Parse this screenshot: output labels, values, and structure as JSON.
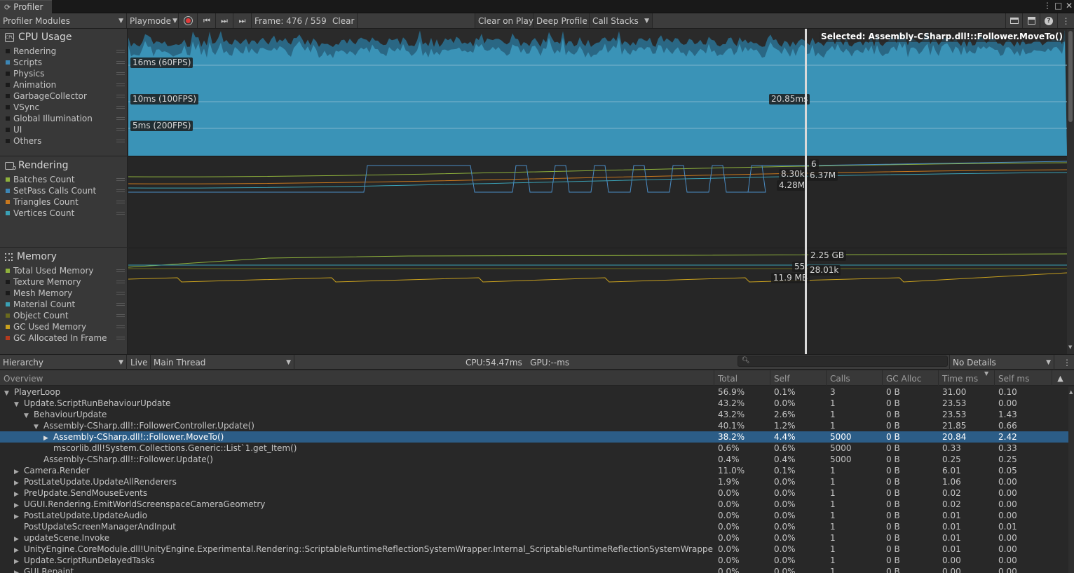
{
  "window": {
    "title": "Profiler",
    "controls": [
      "⋮",
      "□",
      "✕"
    ]
  },
  "toolbar": {
    "modules_label": "Profiler Modules",
    "mode_label": "Playmode",
    "frame_label": "Frame: 476 / 559",
    "clear_label": "Clear",
    "clear_on_play_label": "Clear on Play",
    "deep_profile_label": "Deep Profile",
    "call_stacks_label": "Call Stacks"
  },
  "modules": {
    "cpu": {
      "title": "CPU Usage",
      "legend": [
        {
          "label": "Rendering",
          "color": "#1a1a1a"
        },
        {
          "label": "Scripts",
          "color": "#3d87b6"
        },
        {
          "label": "Physics",
          "color": "#1a1a1a"
        },
        {
          "label": "Animation",
          "color": "#1a1a1a"
        },
        {
          "label": "GarbageCollector",
          "color": "#1a1a1a"
        },
        {
          "label": "VSync",
          "color": "#1a1a1a"
        },
        {
          "label": "Global Illumination",
          "color": "#1a1a1a"
        },
        {
          "label": "UI",
          "color": "#1a1a1a"
        },
        {
          "label": "Others",
          "color": "#1a1a1a"
        }
      ],
      "selected_label": "Selected: Assembly-CSharp.dll!::Follower.MoveTo()",
      "guides": [
        "16ms (60FPS)",
        "10ms (100FPS)",
        "5ms (200FPS)"
      ],
      "frame_value": "20.85ms"
    },
    "rendering": {
      "title": "Rendering",
      "legend": [
        {
          "label": "Batches Count",
          "color": "#8fb23c"
        },
        {
          "label": "SetPass Calls Count",
          "color": "#3d87b6"
        },
        {
          "label": "Triangles Count",
          "color": "#c8781e"
        },
        {
          "label": "Vertices Count",
          "color": "#3aa0b4"
        }
      ],
      "values": [
        "6",
        "8.30k",
        "6.37M",
        "4.28M"
      ]
    },
    "memory": {
      "title": "Memory",
      "legend": [
        {
          "label": "Total Used Memory",
          "color": "#8fb23c"
        },
        {
          "label": "Texture Memory",
          "color": "#1a1a1a"
        },
        {
          "label": "Mesh Memory",
          "color": "#1a1a1a"
        },
        {
          "label": "Material Count",
          "color": "#3aa0b4"
        },
        {
          "label": "Object Count",
          "color": "#6a6a1e"
        },
        {
          "label": "GC Used Memory",
          "color": "#c8a01e"
        },
        {
          "label": "GC Allocated In Frame",
          "color": "#b43a1e"
        }
      ],
      "values": [
        "2.25 GB",
        "55",
        "28.01k",
        "11.9 MB"
      ]
    }
  },
  "details": {
    "view_label": "Hierarchy",
    "live_label": "Live",
    "thread_label": "Main Thread",
    "cpu_gpu_label": "CPU:54.47ms   GPU:--ms",
    "details_label": "No Details",
    "columns": [
      "Overview",
      "Total",
      "Self",
      "Calls",
      "GC Alloc",
      "Time ms",
      "Self ms"
    ],
    "rows": [
      {
        "name": "PlayerLoop",
        "depth": 0,
        "expander": "▼",
        "total": "56.9%",
        "self": "0.1%",
        "calls": "3",
        "gc": "0 B",
        "time": "31.00",
        "selfms": "0.10",
        "selected": false
      },
      {
        "name": "Update.ScriptRunBehaviourUpdate",
        "depth": 1,
        "expander": "▼",
        "total": "43.2%",
        "self": "0.0%",
        "calls": "1",
        "gc": "0 B",
        "time": "23.53",
        "selfms": "0.00",
        "selected": false
      },
      {
        "name": "BehaviourUpdate",
        "depth": 2,
        "expander": "▼",
        "total": "43.2%",
        "self": "2.6%",
        "calls": "1",
        "gc": "0 B",
        "time": "23.53",
        "selfms": "1.43",
        "selected": false
      },
      {
        "name": "Assembly-CSharp.dll!::FollowerController.Update()",
        "depth": 3,
        "expander": "▼",
        "total": "40.1%",
        "self": "1.2%",
        "calls": "1",
        "gc": "0 B",
        "time": "21.85",
        "selfms": "0.66",
        "selected": false
      },
      {
        "name": "Assembly-CSharp.dll!::Follower.MoveTo()",
        "depth": 4,
        "expander": "▶",
        "total": "38.2%",
        "self": "4.4%",
        "calls": "5000",
        "gc": "0 B",
        "time": "20.84",
        "selfms": "2.42",
        "selected": true
      },
      {
        "name": "mscorlib.dll!System.Collections.Generic::List`1.get_Item()",
        "depth": 4,
        "expander": "",
        "total": "0.6%",
        "self": "0.6%",
        "calls": "5000",
        "gc": "0 B",
        "time": "0.33",
        "selfms": "0.33",
        "selected": false
      },
      {
        "name": "Assembly-CSharp.dll!::Follower.Update()",
        "depth": 3,
        "expander": "",
        "total": "0.4%",
        "self": "0.4%",
        "calls": "5000",
        "gc": "0 B",
        "time": "0.25",
        "selfms": "0.25",
        "selected": false
      },
      {
        "name": "Camera.Render",
        "depth": 1,
        "expander": "▶",
        "total": "11.0%",
        "self": "0.1%",
        "calls": "1",
        "gc": "0 B",
        "time": "6.01",
        "selfms": "0.05",
        "selected": false
      },
      {
        "name": "PostLateUpdate.UpdateAllRenderers",
        "depth": 1,
        "expander": "▶",
        "total": "1.9%",
        "self": "0.0%",
        "calls": "1",
        "gc": "0 B",
        "time": "1.06",
        "selfms": "0.00",
        "selected": false
      },
      {
        "name": "PreUpdate.SendMouseEvents",
        "depth": 1,
        "expander": "▶",
        "total": "0.0%",
        "self": "0.0%",
        "calls": "1",
        "gc": "0 B",
        "time": "0.02",
        "selfms": "0.00",
        "selected": false
      },
      {
        "name": "UGUI.Rendering.EmitWorldScreenspaceCameraGeometry",
        "depth": 1,
        "expander": "▶",
        "total": "0.0%",
        "self": "0.0%",
        "calls": "1",
        "gc": "0 B",
        "time": "0.02",
        "selfms": "0.00",
        "selected": false
      },
      {
        "name": "PostLateUpdate.UpdateAudio",
        "depth": 1,
        "expander": "▶",
        "total": "0.0%",
        "self": "0.0%",
        "calls": "1",
        "gc": "0 B",
        "time": "0.01",
        "selfms": "0.00",
        "selected": false
      },
      {
        "name": "PostUpdateScreenManagerAndInput",
        "depth": 1,
        "expander": "",
        "total": "0.0%",
        "self": "0.0%",
        "calls": "1",
        "gc": "0 B",
        "time": "0.01",
        "selfms": "0.01",
        "selected": false
      },
      {
        "name": "updateScene.Invoke",
        "depth": 1,
        "expander": "▶",
        "total": "0.0%",
        "self": "0.0%",
        "calls": "1",
        "gc": "0 B",
        "time": "0.01",
        "selfms": "0.00",
        "selected": false
      },
      {
        "name": "UnityEngine.CoreModule.dll!UnityEngine.Experimental.Rendering::ScriptableRuntimeReflectionSystemWrapper.Internal_ScriptableRuntimeReflectionSystemWrapper_TickRealtim",
        "depth": 1,
        "expander": "▶",
        "total": "0.0%",
        "self": "0.0%",
        "calls": "1",
        "gc": "0 B",
        "time": "0.01",
        "selfms": "0.00",
        "selected": false
      },
      {
        "name": "Update.ScriptRunDelayedTasks",
        "depth": 1,
        "expander": "▶",
        "total": "0.0%",
        "self": "0.0%",
        "calls": "1",
        "gc": "0 B",
        "time": "0.00",
        "selfms": "0.00",
        "selected": false
      },
      {
        "name": "GUI.Repaint",
        "depth": 1,
        "expander": "▶",
        "total": "0.0%",
        "self": "0.0%",
        "calls": "1",
        "gc": "0 B",
        "time": "0.00",
        "selfms": "0.00",
        "selected": false
      }
    ]
  }
}
